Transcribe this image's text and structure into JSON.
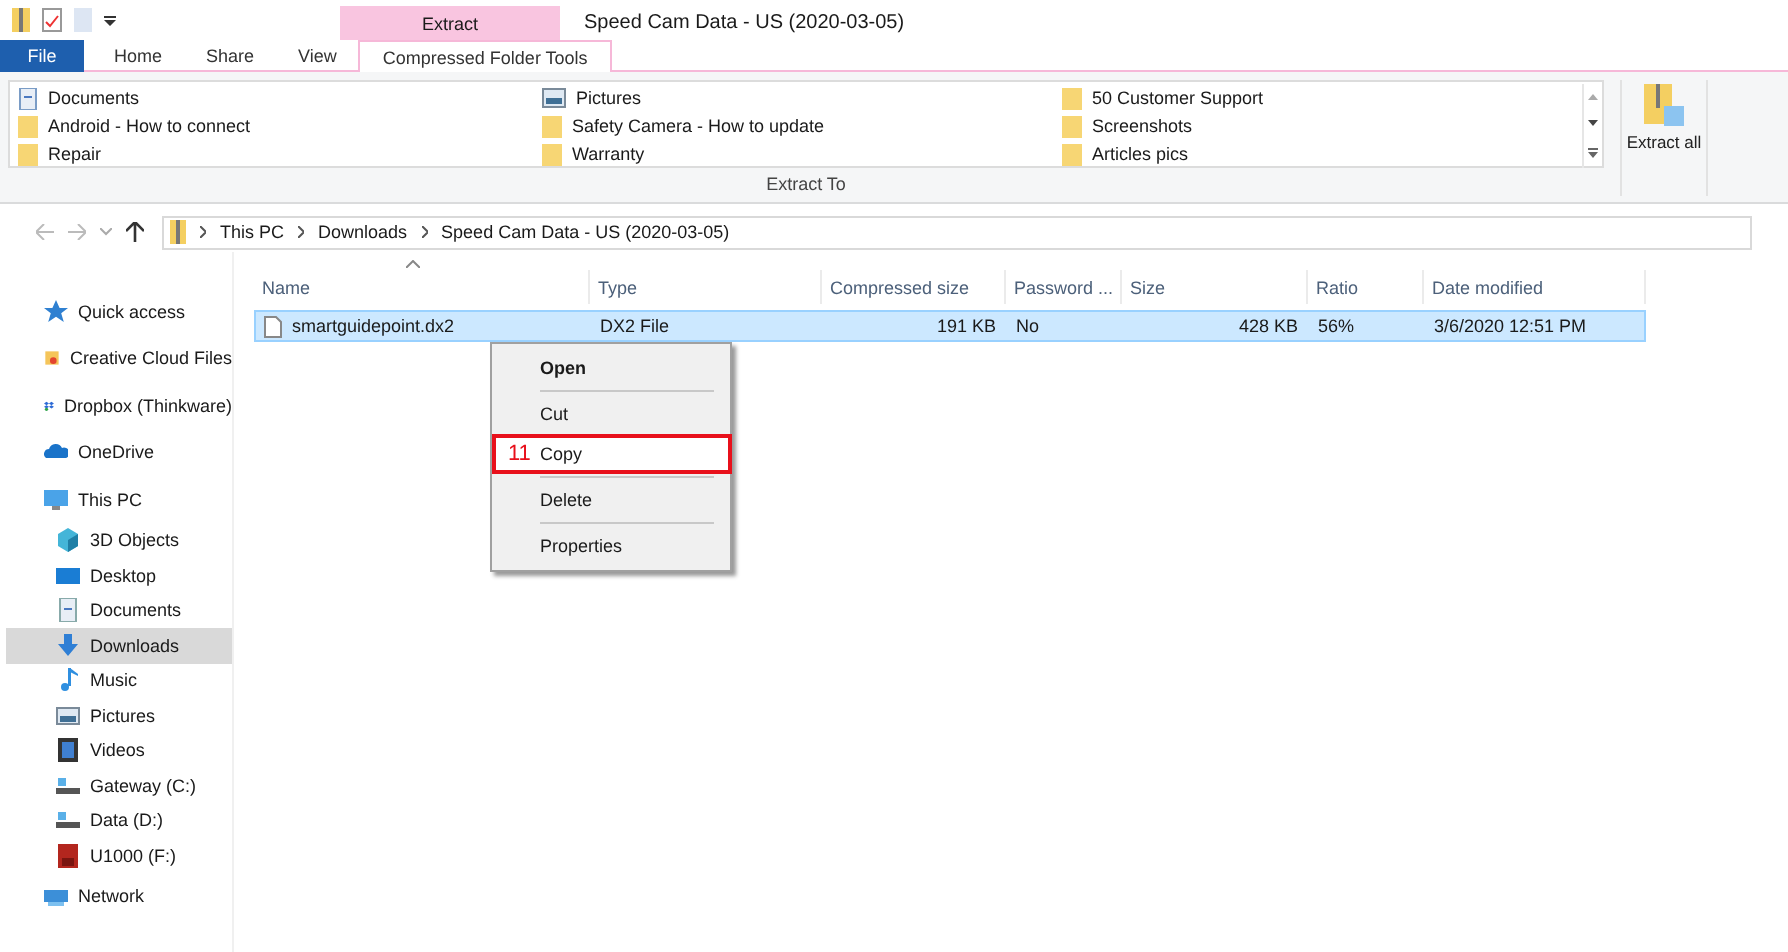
{
  "window": {
    "title": "Speed Cam Data - US (2020-03-05)",
    "context_tab": "Extract"
  },
  "tabs": [
    {
      "label": "File",
      "selected": false,
      "kind": "file"
    },
    {
      "label": "Home",
      "selected": false,
      "kind": "tab"
    },
    {
      "label": "Share",
      "selected": false,
      "kind": "tab"
    },
    {
      "label": "View",
      "selected": false,
      "kind": "tab"
    },
    {
      "label": "Compressed Folder Tools",
      "selected": true,
      "kind": "tab"
    }
  ],
  "ribbon": {
    "destinations": [
      {
        "label": "Documents",
        "kind": "documents"
      },
      {
        "label": "Android - How to connect",
        "kind": "folder"
      },
      {
        "label": "Repair",
        "kind": "folder"
      },
      {
        "label": "Pictures",
        "kind": "pictures"
      },
      {
        "label": "Safety Camera - How to update",
        "kind": "folder"
      },
      {
        "label": "Warranty",
        "kind": "folder"
      },
      {
        "label": "50 Customer Support",
        "kind": "folder"
      },
      {
        "label": "Screenshots",
        "kind": "folder"
      },
      {
        "label": "Articles pics",
        "kind": "folder"
      }
    ],
    "group_label": "Extract To",
    "extract_all": "Extract all"
  },
  "address": {
    "path": [
      "This PC",
      "Downloads",
      "Speed Cam Data - US (2020-03-05)"
    ]
  },
  "sidebar": {
    "items": [
      {
        "label": "Quick access",
        "kind": "star",
        "selected": false
      },
      {
        "label": "Creative Cloud Files",
        "kind": "cloudfiles",
        "selected": false
      },
      {
        "label": "Dropbox (Thinkware)",
        "kind": "dropbox",
        "selected": false
      },
      {
        "label": "OneDrive",
        "kind": "onedrive",
        "selected": false
      },
      {
        "label": "This PC",
        "kind": "pc",
        "selected": false,
        "children": [
          {
            "label": "3D Objects",
            "kind": "cube",
            "selected": false
          },
          {
            "label": "Desktop",
            "kind": "desktop",
            "selected": false
          },
          {
            "label": "Documents",
            "kind": "documents",
            "selected": false
          },
          {
            "label": "Downloads",
            "kind": "downloads",
            "selected": true
          },
          {
            "label": "Music",
            "kind": "music",
            "selected": false
          },
          {
            "label": "Pictures",
            "kind": "pictures",
            "selected": false
          },
          {
            "label": "Videos",
            "kind": "videos",
            "selected": false
          },
          {
            "label": "Gateway (C:)",
            "kind": "drive",
            "selected": false
          },
          {
            "label": "Data (D:)",
            "kind": "drive",
            "selected": false
          },
          {
            "label": "U1000 (F:)",
            "kind": "sd",
            "selected": false
          }
        ]
      },
      {
        "label": "Network",
        "kind": "network",
        "selected": false
      }
    ]
  },
  "table": {
    "columns": [
      "Name",
      "Type",
      "Compressed size",
      "Password ...",
      "Size",
      "Ratio",
      "Date modified"
    ],
    "rows": [
      {
        "cells": [
          "smartguidepoint.dx2",
          "DX2 File",
          "191 KB",
          "No",
          "428 KB",
          "56%",
          "3/6/2020 12:51 PM"
        ],
        "selected": true
      }
    ]
  },
  "context_menu": {
    "items": [
      {
        "label": "Open",
        "kind": "default",
        "highlighted": false
      },
      {
        "kind": "separator"
      },
      {
        "label": "Cut",
        "kind": "item",
        "highlighted": false
      },
      {
        "label": "Copy",
        "kind": "item",
        "highlighted": true,
        "step_label": "11"
      },
      {
        "kind": "separator"
      },
      {
        "label": "Delete",
        "kind": "item",
        "highlighted": false
      },
      {
        "kind": "separator"
      },
      {
        "label": "Properties",
        "kind": "item",
        "highlighted": false
      }
    ]
  }
}
